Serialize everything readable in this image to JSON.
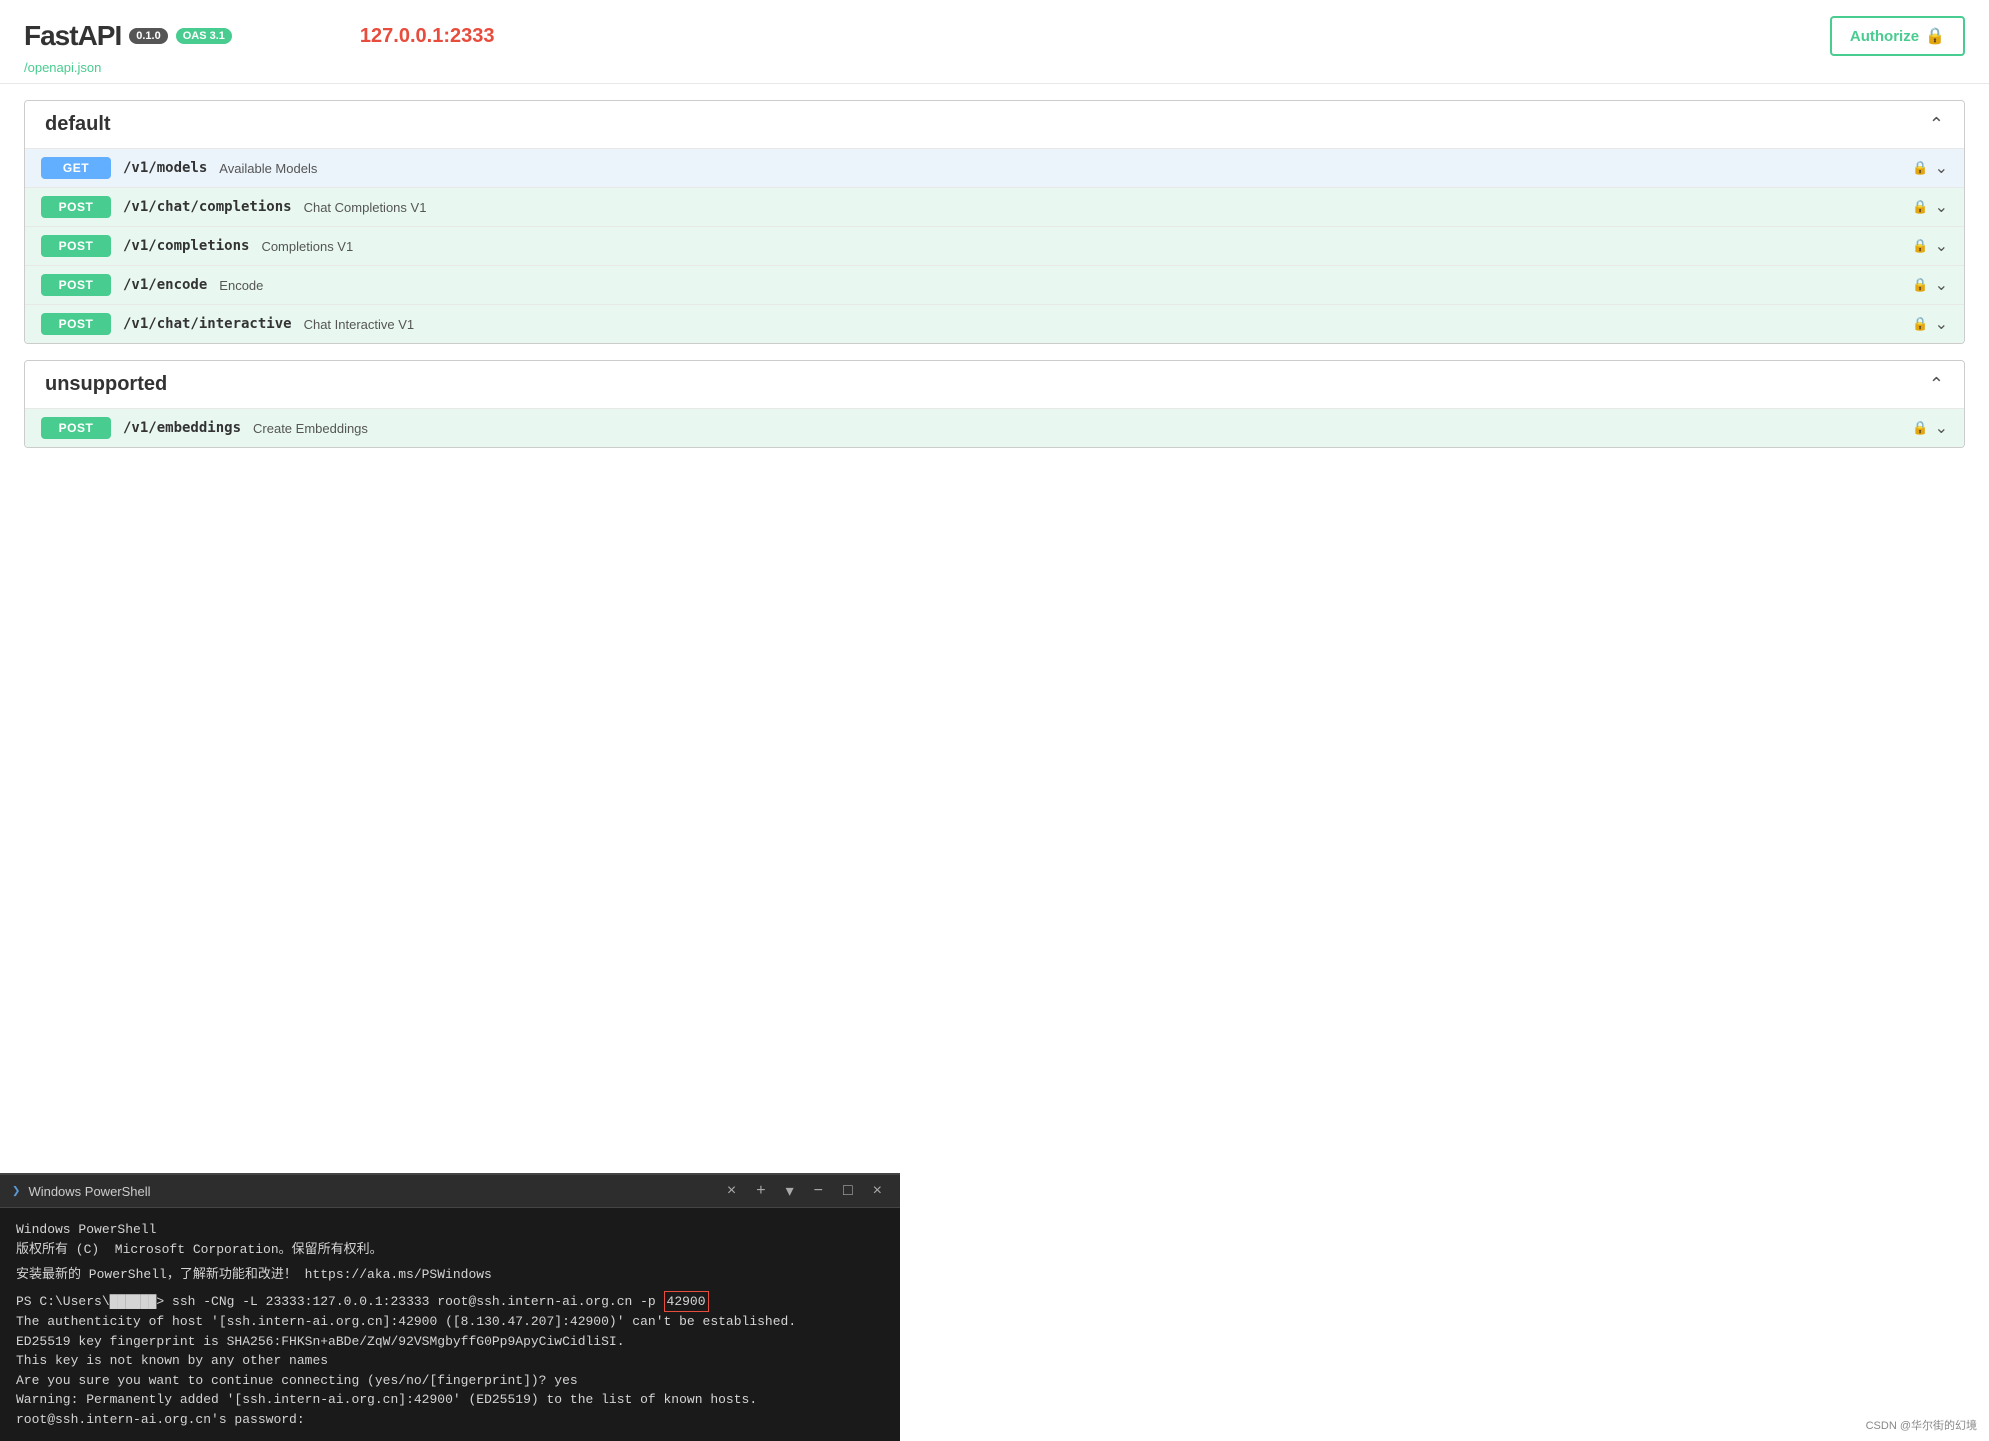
{
  "header": {
    "logo": "FastAPI",
    "badge_version": "0.1.0",
    "badge_oas": "OAS 3.1",
    "server_url": "127.0.0.1:2333",
    "openapi_link": "/openapi.json",
    "authorize_label": "Authorize"
  },
  "sections": [
    {
      "id": "default",
      "title": "default",
      "collapsed": false,
      "rows": [
        {
          "method": "GET",
          "path": "/v1/models",
          "desc": "Available Models"
        },
        {
          "method": "POST",
          "path": "/v1/chat/completions",
          "desc": "Chat Completions V1"
        },
        {
          "method": "POST",
          "path": "/v1/completions",
          "desc": "Completions V1"
        },
        {
          "method": "POST",
          "path": "/v1/encode",
          "desc": "Encode"
        },
        {
          "method": "POST",
          "path": "/v1/chat/interactive",
          "desc": "Chat Interactive V1"
        }
      ]
    },
    {
      "id": "unsupported",
      "title": "unsupported",
      "collapsed": false,
      "rows": [
        {
          "method": "POST",
          "path": "/v1/embeddings",
          "desc": "Create Embeddings"
        }
      ]
    }
  ],
  "terminal": {
    "title": "Windows PowerShell",
    "close_label": "×",
    "minimize_label": "−",
    "maximize_label": "□",
    "plus_label": "+",
    "dropdown_label": "▾",
    "lines": [
      "Windows PowerShell",
      "版权所有 (C)  Microsoft Corporation。保留所有权利。",
      "",
      "安装最新的 PowerShell，了解新功能和改进！ https://aka.ms/PSWindows",
      "",
      "PS C:\\Users\\██████> ssh -CNg -L 23333:127.0.0.1:23333 root@ssh.intern-ai.org.cn -p 42900",
      "The authenticity of host '[ssh.intern-ai.org.cn]:42900 ([8.130.47.207]:42900)' can't be established.",
      "ED25519 key fingerprint is SHA256:FHKSn+aBDe/ZqW/92VSMgbyffG0Pp9ApyCiwCidliSI.",
      "This key is not known by any other names",
      "Are you sure you want to continue connecting (yes/no/[fingerprint])? yes",
      "Warning: Permanently added '[ssh.intern-ai.org.cn]:42900' (ED25519) to the list of known hosts.",
      "root@ssh.intern-ai.org.cn's password:"
    ],
    "highlighted_port": "42900"
  },
  "watermark": "CSDN @华尔街的幻境"
}
